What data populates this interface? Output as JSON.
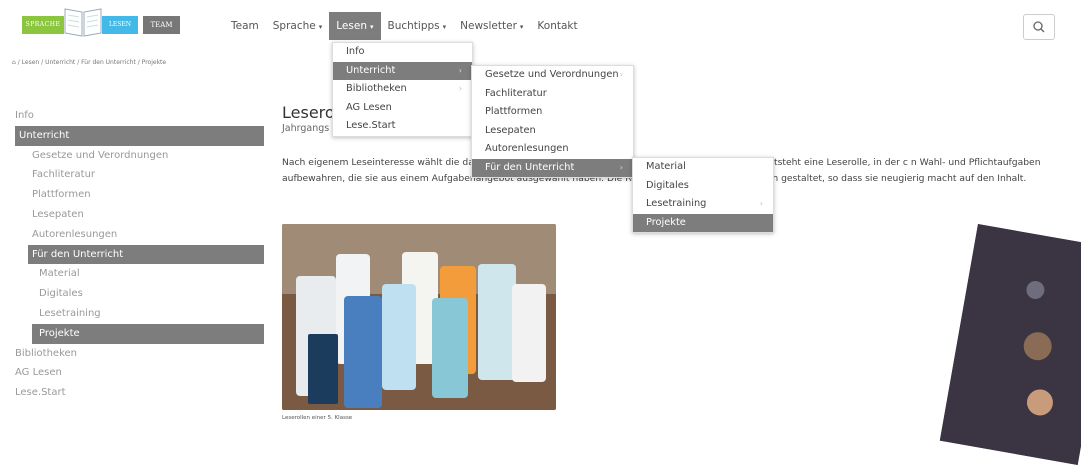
{
  "logo": {
    "part1": "SPRACHE",
    "part2": "LESEN",
    "part3": "TEAM"
  },
  "nav": {
    "items": [
      {
        "label": "Team"
      },
      {
        "label": "Sprache",
        "caret": "▾"
      },
      {
        "label": "Lesen",
        "caret": "▾"
      },
      {
        "label": "Buchtipps",
        "caret": "▾"
      },
      {
        "label": "Newsletter",
        "caret": "▾"
      },
      {
        "label": "Kontakt"
      }
    ]
  },
  "breadcrumb": [
    "Lesen",
    "Unterricht",
    "Für den Unterricht",
    "Projekte"
  ],
  "sidebar": {
    "items": [
      {
        "label": "Info"
      },
      {
        "label": "Unterricht"
      },
      {
        "label": "Gesetze und Verordnungen"
      },
      {
        "label": "Fachliteratur"
      },
      {
        "label": "Plattformen"
      },
      {
        "label": "Lesepaten"
      },
      {
        "label": "Autorenlesungen"
      },
      {
        "label": "Für den Unterricht"
      },
      {
        "label": "Material"
      },
      {
        "label": "Digitales"
      },
      {
        "label": "Lesetraining"
      },
      {
        "label": "Projekte"
      },
      {
        "label": "Bibliotheken"
      },
      {
        "label": "AG Lesen"
      },
      {
        "label": "Lese.Start"
      }
    ]
  },
  "main": {
    "title": "Lesero",
    "subtitle": "Jahrgangs",
    "paragraph": "Nach eigenem Leseinteresse wählt die                                                                                       das sie/er gerne lesen möchte. Parallel zur und nach der Lektüre entsteht eine Leserolle, in der c                                                                                     n Wahl- und Pflichtaufgaben aufbewahren, die sie aus einem Aufgabenangebot ausgewählt haben. Die Rolle selbst wird außer                                                                zum Buch gestaltet, so dass sie neugierig macht auf den Inhalt.",
    "caption": "Leserollen einer 5. Klasse"
  },
  "menu_lesen": [
    "Info",
    "Unterricht",
    "Bibliotheken",
    "AG Lesen",
    "Lese.Start"
  ],
  "menu_unterricht": [
    "Gesetze und Verordnungen",
    "Fachliteratur",
    "Plattformen",
    "Lesepaten",
    "Autorenlesungen",
    "Für den Unterricht"
  ],
  "menu_fuer": [
    "Material",
    "Digitales",
    "Lesetraining",
    "Projekte"
  ],
  "arrow": "›",
  "colors": {
    "selected": "#7d7d7d",
    "logo_green": "#8cc63f",
    "logo_blue": "#42b9e6",
    "logo_gray": "#777777"
  }
}
